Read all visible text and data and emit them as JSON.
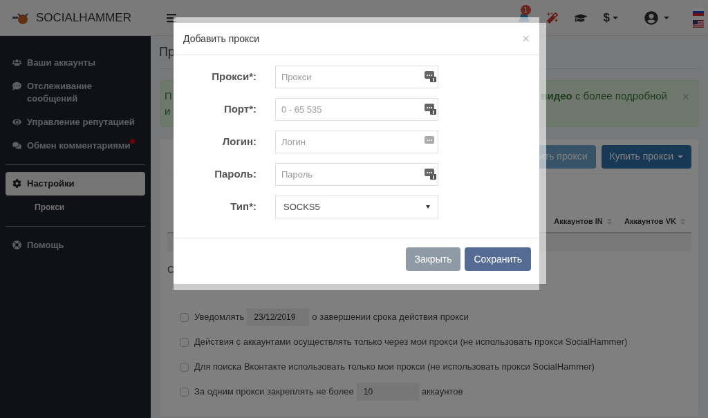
{
  "header": {
    "brand": "SOCIALHAMMER",
    "notification_count": "1",
    "currency": "$"
  },
  "sidebar": {
    "items": [
      {
        "label": "Ваши аккаунты",
        "selected": false,
        "dot": false
      },
      {
        "label": "Отслеживание сообщений",
        "selected": false,
        "dot": false
      },
      {
        "label": "Управление репутацией",
        "selected": false,
        "dot": false
      },
      {
        "label": "Обмен комментариями",
        "selected": false,
        "dot": true
      },
      {
        "label": "Настройки",
        "selected": true,
        "dot": false,
        "children": [
          {
            "label": "Прокси"
          }
        ]
      },
      {
        "label": "Помощь",
        "selected": false,
        "dot": false
      }
    ]
  },
  "page": {
    "title": "Пр",
    "alert": {
      "line1_left": "П",
      "line1_right": "**видео** с более подробной",
      "line2_left": "и",
      "close": "×"
    },
    "toolbar": [
      {
        "label": "ить прокси",
        "disabled": true,
        "caret": false
      },
      {
        "label": "Купить прокси",
        "disabled": false,
        "caret": true
      }
    ],
    "table": {
      "columns": [
        "Аккаунтов IN",
        "Аккаунтов VK"
      ]
    },
    "below_table": "С",
    "options": [
      {
        "checked": false,
        "before": "Уведомлять",
        "value": "23/12/2019",
        "after": "о завершении срока действия прокси"
      },
      {
        "checked": false,
        "before": "Действия с аккаунтами осуществлять только через мои прокси (не использовать прокси SocialHammer)"
      },
      {
        "checked": false,
        "before": "Для поиска Вконтакте использовать только мои прокси (не использовать прокси SocialHammer)"
      },
      {
        "checked": false,
        "before": "За одним прокси закреплять не более",
        "value": "10",
        "after": "аккаунтов"
      }
    ]
  },
  "modal": {
    "title": "Добавить прокси",
    "close": "×",
    "fields": [
      {
        "kind": "input",
        "label": "Прокси*:",
        "placeholder": "Прокси"
      },
      {
        "kind": "input",
        "label": "Порт*:",
        "placeholder": "0 - 65 535"
      },
      {
        "kind": "input",
        "label": "Логин:",
        "placeholder": "Логин"
      },
      {
        "kind": "input",
        "label": "Пароль:",
        "placeholder": "Пароль"
      },
      {
        "kind": "select",
        "label": "Тип*:",
        "value": "SOCKS5"
      }
    ],
    "buttons": [
      {
        "kind": "secondary",
        "label": "Закрыть"
      },
      {
        "kind": "primary",
        "label": "Сохранить"
      }
    ]
  }
}
